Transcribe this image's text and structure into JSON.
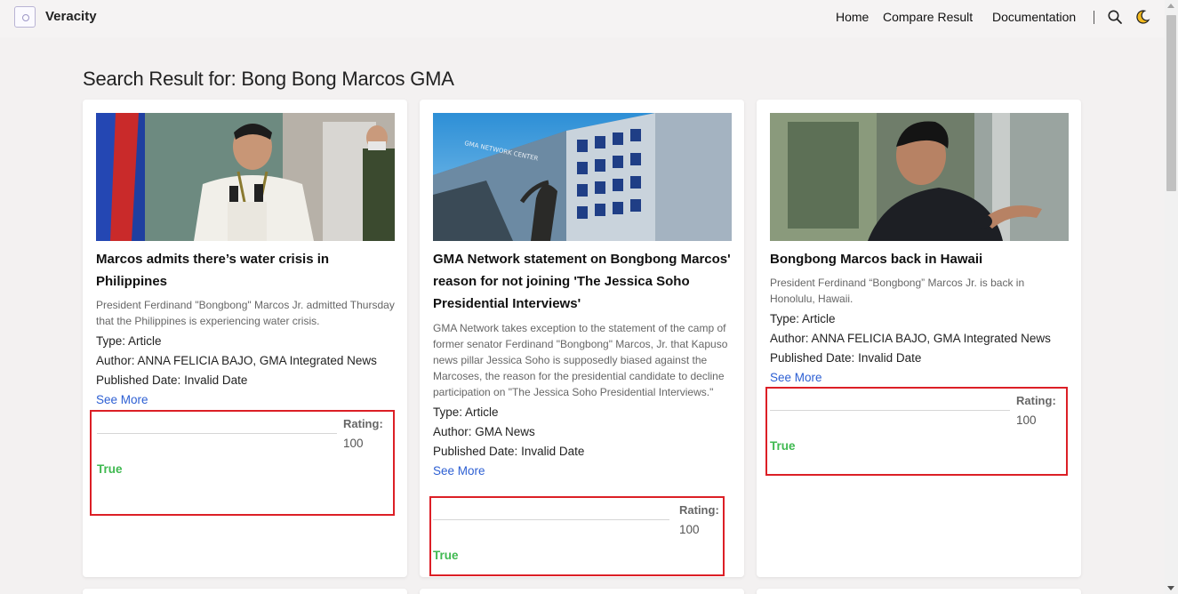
{
  "nav": {
    "brand": "Veracity",
    "links": [
      "Home",
      "Compare Result",
      "Documentation"
    ],
    "search_icon": "search-icon",
    "theme_icon": "moon-icon"
  },
  "page": {
    "title": "Search Result for: Bong Bong Marcos GMA"
  },
  "labels": {
    "type_prefix": "Type: ",
    "author_prefix": "Author: ",
    "date_prefix": "Published Date: ",
    "see_more": "See More",
    "rating": "Rating:"
  },
  "cards": [
    {
      "title": "Marcos admits there’s water crisis in Philippines",
      "description": "President Ferdinand \"Bongbong\" Marcos Jr. admitted Thursday that the Philippines is experiencing water crisis.",
      "type": "Article",
      "author": "ANNA FELICIA BAJO, GMA Integrated News",
      "published_date": "Invalid Date",
      "rating": "100",
      "verdict": "True"
    },
    {
      "title": "GMA Network statement on Bongbong Marcos' reason for not joining 'The Jessica Soho Presidential Interviews'",
      "description": "GMA Network takes exception to the statement of the camp of former senator Ferdinand \"Bongbong\" Marcos, Jr. that Kapuso news pillar Jessica Soho is supposedly biased against the Marcoses, the reason for the presidential candidate to decline participation on \"The Jessica Soho Presidential Interviews.\"",
      "type": "Article",
      "author": "GMA News",
      "published_date": "Invalid Date",
      "rating": "100",
      "verdict": "True"
    },
    {
      "title": "Bongbong Marcos back in Hawaii",
      "description": "President Ferdinand “Bongbong” Marcos Jr. is back in Honolulu, Hawaii.",
      "type": "Article",
      "author": "ANNA FELICIA BAJO, GMA Integrated News",
      "published_date": "Invalid Date",
      "rating": "100",
      "verdict": "True"
    }
  ],
  "colors": {
    "verdict_true": "#3fb950",
    "highlight_border": "#dc1f26",
    "link": "#2d5fd3"
  }
}
